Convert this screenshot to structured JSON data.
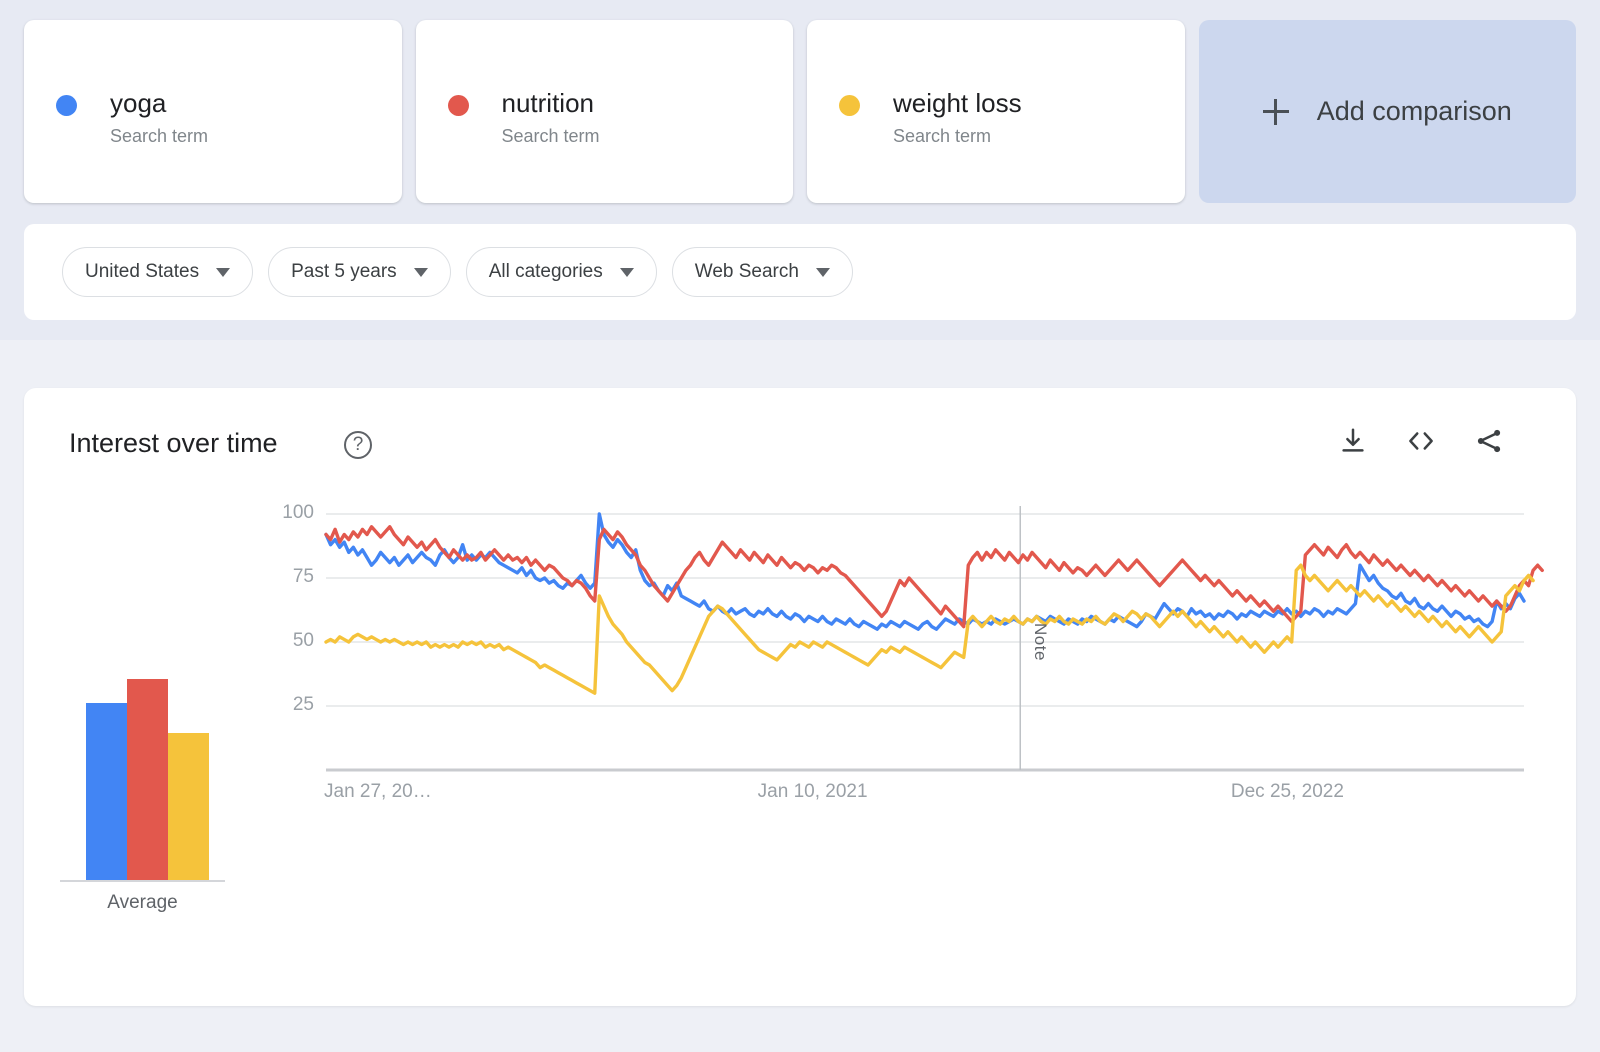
{
  "terms": [
    {
      "name": "yoga",
      "subtitle": "Search term",
      "color": "#4285F4",
      "dot": "legend-dot"
    },
    {
      "name": "nutrition",
      "subtitle": "Search term",
      "color": "#E2584D",
      "dot": "legend-dot"
    },
    {
      "name": "weight loss",
      "subtitle": "Search term",
      "color": "#F5C33B",
      "dot": "legend-dot"
    }
  ],
  "add_comparison": {
    "label": "Add comparison",
    "icon": "plus-icon"
  },
  "filters": [
    {
      "label": "United States",
      "name": "region-filter"
    },
    {
      "label": "Past 5 years",
      "name": "time-range-filter"
    },
    {
      "label": "All categories",
      "name": "category-filter"
    },
    {
      "label": "Web Search",
      "name": "search-type-filter"
    }
  ],
  "panel": {
    "title": "Interest over time",
    "help_icon": "?",
    "actions": [
      {
        "name": "download-icon",
        "label": "Download"
      },
      {
        "name": "embed-icon",
        "label": "Embed"
      },
      {
        "name": "share-icon",
        "label": "Share"
      }
    ]
  },
  "average": {
    "label": "Average",
    "values": [
      65,
      74,
      54
    ]
  },
  "chart_data": {
    "type": "line",
    "title": "Interest over time",
    "xlabel": "",
    "ylabel": "",
    "ylim": [
      0,
      100
    ],
    "yticks": [
      25,
      50,
      75,
      100
    ],
    "ytick_labels": [
      "25",
      "50",
      "75",
      "100"
    ],
    "grid": true,
    "legend_position": "top-cards",
    "x_axis_labels": [
      "Jan 27, 20…",
      "Jan 10, 2021",
      "Dec 25, 2022"
    ],
    "x_axis_label_positions": [
      0.0,
      0.362,
      0.757
    ],
    "annotation": {
      "label": "Note",
      "x_fraction": 0.5795
    },
    "n_points": 261,
    "series": [
      {
        "name": "yoga",
        "color": "#4285F4",
        "values": [
          92,
          88,
          90,
          87,
          89,
          85,
          87,
          84,
          86,
          83,
          80,
          82,
          85,
          83,
          81,
          83,
          80,
          82,
          84,
          81,
          83,
          85,
          83,
          82,
          80,
          84,
          86,
          83,
          81,
          83,
          88,
          82,
          84,
          82,
          84,
          83,
          85,
          83,
          81,
          80,
          79,
          78,
          77,
          79,
          76,
          78,
          75,
          74,
          75,
          73,
          74,
          72,
          71,
          73,
          72,
          74,
          76,
          73,
          71,
          73,
          100,
          92,
          89,
          87,
          90,
          88,
          85,
          83,
          86,
          78,
          74,
          72,
          73,
          70,
          68,
          72,
          70,
          73,
          68,
          67,
          66,
          65,
          64,
          66,
          63,
          62,
          64,
          62,
          61,
          63,
          61,
          62,
          63,
          61,
          60,
          62,
          61,
          63,
          61,
          60,
          62,
          60,
          59,
          61,
          60,
          58,
          60,
          59,
          58,
          60,
          58,
          57,
          59,
          58,
          57,
          59,
          57,
          56,
          58,
          57,
          56,
          55,
          57,
          56,
          58,
          57,
          56,
          58,
          57,
          56,
          55,
          57,
          58,
          56,
          55,
          57,
          59,
          58,
          57,
          59,
          58,
          57,
          59,
          58,
          57,
          58,
          57,
          59,
          58,
          57,
          58,
          59,
          58,
          57,
          59,
          58,
          60,
          59,
          58,
          60,
          59,
          58,
          57,
          59,
          58,
          57,
          59,
          58,
          60,
          59,
          58,
          57,
          59,
          58,
          60,
          59,
          58,
          57,
          56,
          58,
          61,
          60,
          59,
          62,
          65,
          63,
          61,
          63,
          62,
          60,
          63,
          61,
          62,
          60,
          61,
          59,
          61,
          60,
          62,
          61,
          59,
          61,
          60,
          62,
          61,
          60,
          62,
          61,
          60,
          62,
          61,
          63,
          61,
          62,
          60,
          62,
          61,
          63,
          62,
          60,
          62,
          61,
          63,
          62,
          61,
          63,
          65,
          80,
          77,
          74,
          76,
          73,
          71,
          70,
          68,
          67,
          69,
          66,
          65,
          67,
          64,
          63,
          65,
          63,
          62,
          64,
          62,
          60,
          62,
          61,
          59,
          60,
          58,
          59,
          57,
          56,
          58,
          66,
          63,
          65,
          63,
          67,
          69,
          66
        ]
      },
      {
        "name": "nutrition",
        "color": "#E2584D",
        "values": [
          92,
          90,
          94,
          89,
          92,
          90,
          93,
          91,
          94,
          92,
          95,
          93,
          91,
          93,
          95,
          92,
          90,
          88,
          91,
          89,
          87,
          89,
          86,
          88,
          90,
          87,
          85,
          83,
          86,
          84,
          82,
          84,
          82,
          83,
          85,
          82,
          84,
          86,
          84,
          82,
          84,
          82,
          83,
          81,
          83,
          80,
          82,
          80,
          78,
          80,
          79,
          77,
          75,
          74,
          72,
          74,
          73,
          71,
          68,
          66,
          90,
          94,
          92,
          90,
          93,
          91,
          88,
          86,
          84,
          80,
          78,
          75,
          72,
          70,
          68,
          66,
          69,
          72,
          75,
          78,
          80,
          83,
          85,
          82,
          80,
          83,
          86,
          89,
          87,
          85,
          83,
          86,
          84,
          82,
          85,
          83,
          81,
          84,
          82,
          80,
          83,
          81,
          79,
          81,
          80,
          78,
          80,
          79,
          77,
          79,
          78,
          80,
          79,
          77,
          76,
          74,
          72,
          70,
          68,
          66,
          64,
          62,
          60,
          62,
          66,
          70,
          74,
          72,
          75,
          73,
          71,
          69,
          67,
          65,
          63,
          61,
          64,
          62,
          60,
          58,
          56,
          80,
          83,
          85,
          82,
          85,
          83,
          86,
          84,
          82,
          85,
          83,
          81,
          84,
          82,
          85,
          83,
          81,
          79,
          82,
          80,
          78,
          81,
          79,
          77,
          79,
          78,
          76,
          78,
          80,
          78,
          76,
          78,
          80,
          82,
          80,
          78,
          80,
          82,
          80,
          78,
          76,
          74,
          72,
          74,
          76,
          78,
          80,
          82,
          80,
          78,
          76,
          74,
          76,
          74,
          72,
          74,
          72,
          70,
          68,
          70,
          68,
          66,
          68,
          66,
          64,
          66,
          64,
          62,
          64,
          62,
          60,
          58,
          60,
          62,
          84,
          86,
          88,
          86,
          84,
          87,
          85,
          83,
          86,
          88,
          85,
          83,
          85,
          83,
          81,
          84,
          82,
          80,
          82,
          80,
          78,
          80,
          78,
          76,
          78,
          76,
          74,
          76,
          74,
          72,
          74,
          72,
          70,
          72,
          70,
          68,
          70,
          68,
          66,
          68,
          66,
          64,
          66,
          64,
          62,
          64,
          68,
          72,
          74,
          72,
          78,
          80,
          78
        ]
      },
      {
        "name": "weight loss",
        "color": "#F5C33B",
        "values": [
          50,
          51,
          50,
          52,
          51,
          50,
          52,
          53,
          52,
          51,
          52,
          51,
          50,
          51,
          50,
          51,
          50,
          49,
          50,
          49,
          50,
          49,
          50,
          48,
          49,
          48,
          49,
          48,
          49,
          48,
          50,
          49,
          50,
          49,
          50,
          48,
          49,
          48,
          49,
          47,
          48,
          47,
          46,
          45,
          44,
          43,
          42,
          40,
          41,
          40,
          39,
          38,
          37,
          36,
          35,
          34,
          33,
          32,
          31,
          30,
          68,
          64,
          60,
          57,
          55,
          53,
          50,
          48,
          46,
          44,
          42,
          41,
          39,
          37,
          35,
          33,
          31,
          33,
          36,
          40,
          44,
          48,
          52,
          56,
          60,
          62,
          64,
          63,
          61,
          59,
          57,
          55,
          53,
          51,
          49,
          47,
          46,
          45,
          44,
          43,
          45,
          47,
          49,
          48,
          50,
          49,
          48,
          50,
          49,
          48,
          50,
          49,
          48,
          47,
          46,
          45,
          44,
          43,
          42,
          41,
          43,
          45,
          47,
          46,
          48,
          47,
          46,
          48,
          47,
          46,
          45,
          44,
          43,
          42,
          41,
          40,
          42,
          44,
          46,
          45,
          44,
          58,
          60,
          58,
          56,
          58,
          60,
          58,
          57,
          59,
          58,
          60,
          58,
          57,
          59,
          58,
          60,
          58,
          57,
          59,
          58,
          60,
          58,
          57,
          59,
          58,
          57,
          59,
          58,
          60,
          58,
          57,
          59,
          61,
          60,
          58,
          60,
          62,
          61,
          59,
          61,
          60,
          58,
          56,
          58,
          60,
          62,
          60,
          62,
          60,
          58,
          56,
          58,
          56,
          54,
          56,
          54,
          52,
          54,
          52,
          50,
          52,
          50,
          48,
          50,
          48,
          46,
          48,
          50,
          48,
          50,
          52,
          50,
          78,
          80,
          76,
          74,
          76,
          74,
          72,
          70,
          72,
          74,
          72,
          70,
          72,
          70,
          68,
          70,
          68,
          66,
          68,
          66,
          64,
          66,
          64,
          62,
          64,
          62,
          60,
          62,
          60,
          58,
          60,
          58,
          56,
          58,
          56,
          54,
          56,
          54,
          52,
          54,
          56,
          54,
          52,
          50,
          52,
          54,
          68,
          70,
          72,
          70,
          74,
          76,
          74
        ]
      }
    ]
  }
}
